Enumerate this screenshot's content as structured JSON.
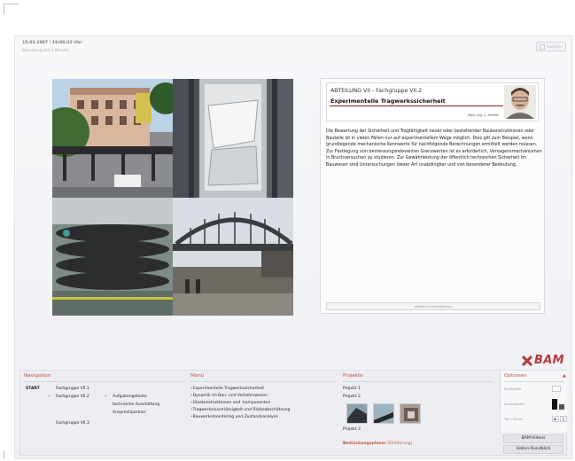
{
  "header": {
    "datetime": "15.03.2007 | 16:00:23 Uhr",
    "subtitle": "Benutzung seit 2 Minuten",
    "top_button_label": "beenden"
  },
  "article": {
    "department": "ABTEILUNG VII - Fachgruppe VII.2",
    "title": "Experimentelle Tragwerkssicherheit",
    "author": "Dipl.-Ing. J. Herter",
    "body": "Die Bewertung der Sicherheit und Tragfähigkeit neuer oder bestehender Baukonstruktionen oder Bauteile ist in vielen Fällen nur auf experimentellem Wege möglich. Dies gilt zum Beispiel, wenn grundlegende mechanische Kennwerte für nachfolgende Berechnungen ermittelt werden müssen. Zur Festlegung von bemessungsrelevanten Grenzwerten ist es erforderlich, Versagensmechanismen in Bruchversuchen zu studieren. Zur Gewährleistung der öffentlich technischen Sicherheit im Bauwesen sind Untersuchungen dieser Art unabdingbar und von besonderer Bedeutung.",
    "more_button": "weitere Informationen"
  },
  "logo": {
    "text": "BAM",
    "color": "#b23a3a"
  },
  "navigation": {
    "title": "Navigation",
    "start": "START",
    "items": [
      "Fachgruppe VII.1",
      "Fachgruppe VII.2",
      "Fachgruppe VII.3"
    ],
    "sub_items": [
      "Aufgabengebiete",
      "technische Ausstattung",
      "Ansprechpartner"
    ]
  },
  "menu": {
    "title": "Menü",
    "items": [
      "Experimentelle Tragwerkssicherheit",
      "Dynamik im Bau- und Verkehrswesen",
      "Glaskonstruktionen und -komponenten",
      "Tragwerkszuverlässigkeit und Risikoabschätzung",
      "Bauwerksmonitoring und Zustandsanalyse"
    ]
  },
  "projects": {
    "title": "Projekte",
    "items": [
      "Projekt 1",
      "Projekt 2",
      "Projekt 3"
    ],
    "link": "Bestückungsplaner",
    "link_suffix": "(Einführung)"
  },
  "options": {
    "title": "Optionen",
    "font_size_label": "Fontgröße",
    "display_label": "Anzeigezahl",
    "sound_label": "Ton / Musik",
    "buttons": [
      "BAM-Videos",
      "Hallen-Rundblick"
    ]
  },
  "colors": {
    "accent": "#c9503a",
    "title_rule": "#8a1c1c"
  }
}
